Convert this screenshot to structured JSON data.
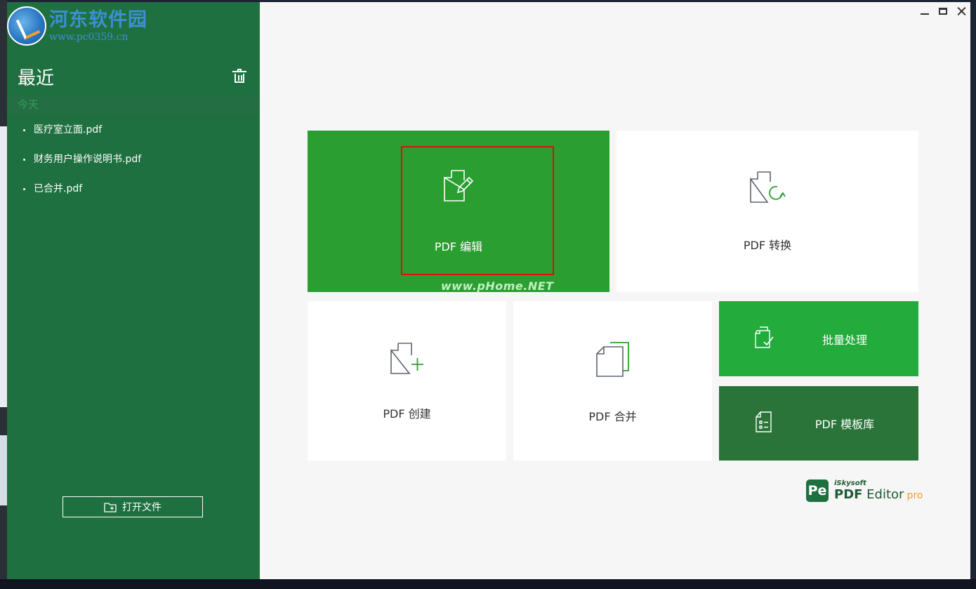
{
  "watermark": {
    "title": "河东软件园",
    "url": "www.pc0359.cn"
  },
  "sidebar": {
    "title": "最近",
    "today_label": "今天",
    "recent_files": [
      "医疗室立面.pdf",
      "财务用户操作说明书.pdf",
      "已合并.pdf"
    ],
    "open_file_label": "打开文件"
  },
  "tiles": {
    "edit": "PDF 编辑",
    "convert": "PDF 转换",
    "create": "PDF 创建",
    "merge": "PDF 合并",
    "batch": "批量处理",
    "template": "PDF 模板库"
  },
  "overlay_watermark": "www.pHome.NET",
  "brand": {
    "logo": "Pe",
    "company": "iSkysoft",
    "product_bold": "PDF",
    "product_rest": " Editor",
    "edition": "pro"
  },
  "colors": {
    "sidebar": "#1f7040",
    "edit_tile": "#2b9e32",
    "batch_tile": "#23ab3b",
    "template_tile": "#2a7439",
    "highlight": "#d9100f",
    "pro": "#f0a030"
  }
}
